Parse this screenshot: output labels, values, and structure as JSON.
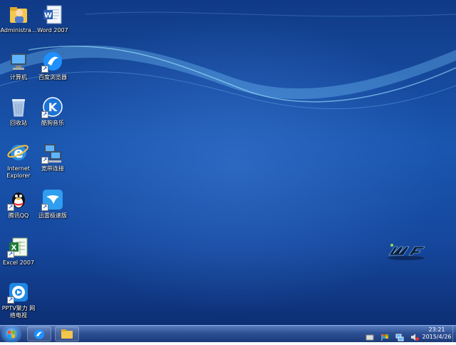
{
  "desktop": {
    "icons": [
      {
        "label": "Administra...",
        "icon": "user-folder-icon"
      },
      {
        "label": "Word 2007",
        "icon": "word-document-icon"
      },
      {
        "label": "计算机",
        "icon": "computer-icon"
      },
      {
        "label": "百度浏览器",
        "icon": "baidu-browser-icon"
      },
      {
        "label": "回收站",
        "icon": "recycle-bin-icon"
      },
      {
        "label": "酷狗音乐",
        "icon": "kugou-music-icon"
      },
      {
        "label": "Internet Explorer",
        "icon": "internet-explorer-icon"
      },
      {
        "label": "宽带连接",
        "icon": "broadband-connection-icon"
      },
      {
        "label": "腾讯QQ",
        "icon": "qq-penguin-icon"
      },
      {
        "label": "迅雷极速版",
        "icon": "xunlei-bird-icon"
      },
      {
        "label": "Excel 2007",
        "icon": "excel-document-icon"
      },
      {
        "label": "PPTV聚力 网络电视",
        "icon": "pptv-icon"
      }
    ]
  },
  "taskbar": {
    "pinned": [
      {
        "icon": "browser-icon"
      },
      {
        "icon": "folder-icon"
      }
    ],
    "tray": [
      {
        "icon": "keyboard-icon"
      },
      {
        "icon": "flag-icon"
      },
      {
        "icon": "network-icon"
      },
      {
        "icon": "volume-muted-icon"
      }
    ],
    "clock": {
      "time": "23:21",
      "date": "2015/4/26"
    }
  },
  "colors": {
    "desktop": "#1a56b0",
    "taskbar": "#2d4f93"
  }
}
